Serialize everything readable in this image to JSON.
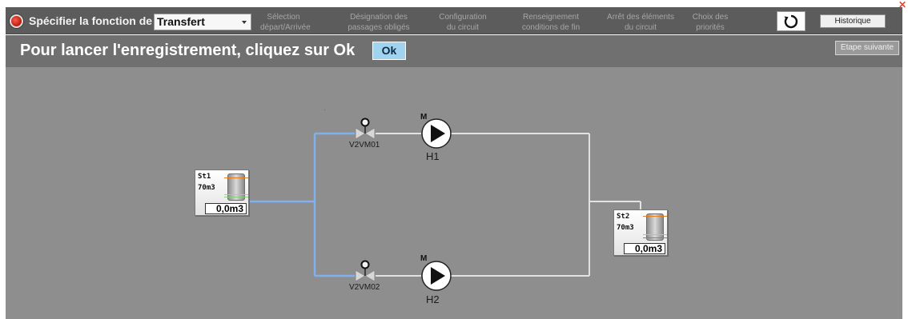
{
  "header": {
    "function_label": "Spécifier la fonction de :",
    "function_value": "Transfert",
    "steps": [
      {
        "line1": "Sélection",
        "line2": "départ/Arrivée"
      },
      {
        "line1": "Désignation des",
        "line2": "passages obligés"
      },
      {
        "line1": "Configuration",
        "line2": "du circuit"
      },
      {
        "line1": "Renseignement",
        "line2": "conditions de fin"
      },
      {
        "line1": "Arrêt des éléments",
        "line2": "du circuit"
      },
      {
        "line1": "Choix des",
        "line2": "priorités"
      }
    ],
    "reset_icon": "refresh-icon",
    "history_label": "Historique"
  },
  "instruction": {
    "text": "Pour lancer l'enregistrement, cliquez sur Ok",
    "ok_label": "Ok",
    "next_label": "Etape suivante"
  },
  "diagram": {
    "tanks": [
      {
        "name": "St1",
        "capacity": "70m3",
        "volume": "0,0m3"
      },
      {
        "name": "St2",
        "capacity": "70m3",
        "volume": "0,0m3"
      }
    ],
    "valves": [
      {
        "label": "V2VM01"
      },
      {
        "label": "V2VM02"
      }
    ],
    "pumps": [
      {
        "label": "H1",
        "motor": "M"
      },
      {
        "label": "H2",
        "motor": "M"
      }
    ]
  },
  "colors": {
    "active_pipe": "#7fb2ec",
    "idle_pipe": "#e2e2e2",
    "background": "#8e8e8e"
  }
}
